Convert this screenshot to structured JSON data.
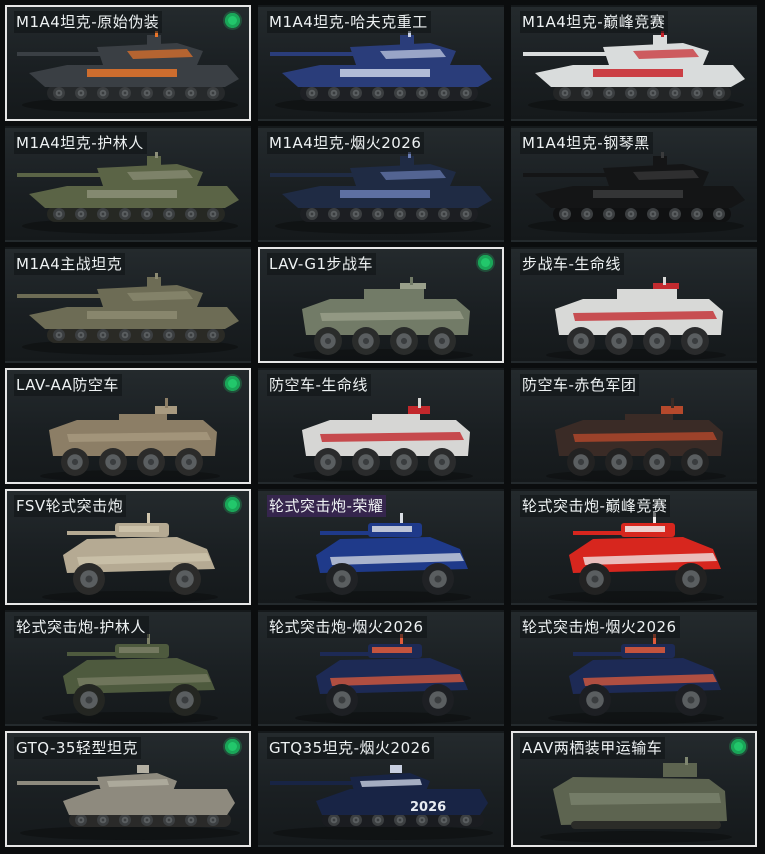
{
  "grid": {
    "items": [
      {
        "label": "M1A4坦克-原始伪装",
        "equipped": true,
        "kind": "tank",
        "body": "#3a3f44",
        "accent": "#e8752a",
        "wheel": "#26292b"
      },
      {
        "label": "M1A4坦克-哈夫克重工",
        "equipped": false,
        "kind": "tank",
        "body": "#2a3d7a",
        "accent": "#c9d2e8",
        "wheel": "#1e2024"
      },
      {
        "label": "M1A4坦克-巅峰竞赛",
        "equipped": false,
        "kind": "tank",
        "body": "#d9dcdc",
        "accent": "#c8232a",
        "wheel": "#232526"
      },
      {
        "label": "M1A4坦克-护林人",
        "equipped": false,
        "kind": "tank",
        "body": "#5b6446",
        "accent": "#8c8f78",
        "wheel": "#262823"
      },
      {
        "label": "M1A4坦克-烟火2026",
        "equipped": false,
        "kind": "tank",
        "body": "#1f2b44",
        "accent": "#6a7db3",
        "wheel": "#1c1e22"
      },
      {
        "label": "M1A4坦克-钢琴黑",
        "equipped": false,
        "kind": "tank",
        "body": "#141516",
        "accent": "#3a3b3c",
        "wheel": "#101112"
      },
      {
        "label": "M1A4主战坦克",
        "equipped": false,
        "kind": "tank",
        "body": "#6d6c55",
        "accent": "#8d8b72",
        "wheel": "#2a2a25"
      },
      {
        "label": "LAV-G1步战车",
        "equipped": true,
        "kind": "apc",
        "body": "#727b67",
        "accent": "#9aa08b",
        "wheel": "#2a2c2b"
      },
      {
        "label": "步战车-生命线",
        "equipped": false,
        "kind": "apc",
        "body": "#d8d9d7",
        "accent": "#c32b2f",
        "wheel": "#2a2b2c"
      },
      {
        "label": "LAV-AA防空车",
        "equipped": true,
        "kind": "aa",
        "body": "#8c7e66",
        "accent": "#a89a80",
        "wheel": "#2b2b2a"
      },
      {
        "label": "防空车-生命线",
        "equipped": false,
        "kind": "aa",
        "body": "#d6d6d4",
        "accent": "#c2272b",
        "wheel": "#2a2b2c"
      },
      {
        "label": "防空车-赤色军团",
        "equipped": false,
        "kind": "aa",
        "body": "#3a2b26",
        "accent": "#b5492c",
        "wheel": "#222"
      },
      {
        "label": "FSV轮式突击炮",
        "equipped": true,
        "kind": "fsv",
        "body": "#b5aa93",
        "accent": "#cfc5ad",
        "wheel": "#2b2b2a"
      },
      {
        "label": "轮式突击炮-荣耀",
        "equipped": false,
        "kind": "fsv",
        "body": "#1f3a8a",
        "accent": "#d9dde3",
        "wheel": "#202225",
        "purple": true
      },
      {
        "label": "轮式突击炮-巅峰竞赛",
        "equipped": false,
        "kind": "fsv",
        "body": "#d7261e",
        "accent": "#f0f0f0",
        "wheel": "#222"
      },
      {
        "label": "轮式突击炮-护林人",
        "equipped": false,
        "kind": "fsv",
        "body": "#4e5a3e",
        "accent": "#7b7f66",
        "wheel": "#242622"
      },
      {
        "label": "轮式突击炮-烟火2026",
        "equipped": false,
        "kind": "fsv",
        "body": "#1d2a55",
        "accent": "#e05b3b",
        "wheel": "#1d1f23"
      },
      {
        "label": "轮式突击炮-烟火2026",
        "equipped": false,
        "kind": "fsv",
        "body": "#1d2a55",
        "accent": "#e05b3b",
        "wheel": "#1d1f23"
      },
      {
        "label": "GTQ-35轻型坦克",
        "equipped": true,
        "kind": "light",
        "body": "#8e8a7e",
        "accent": "#b4b0a3",
        "wheel": "#2a2a29"
      },
      {
        "label": "GTQ35坦克-烟火2026",
        "equipped": false,
        "kind": "light",
        "body": "#182445",
        "accent": "#c8cfe0",
        "wheel": "#1a1c20",
        "badge": "2026"
      },
      {
        "label": "AAV两栖装甲运输车",
        "equipped": true,
        "kind": "aav",
        "body": "#5d6450",
        "accent": "#7f8670",
        "wheel": "#2b2c28"
      }
    ]
  }
}
